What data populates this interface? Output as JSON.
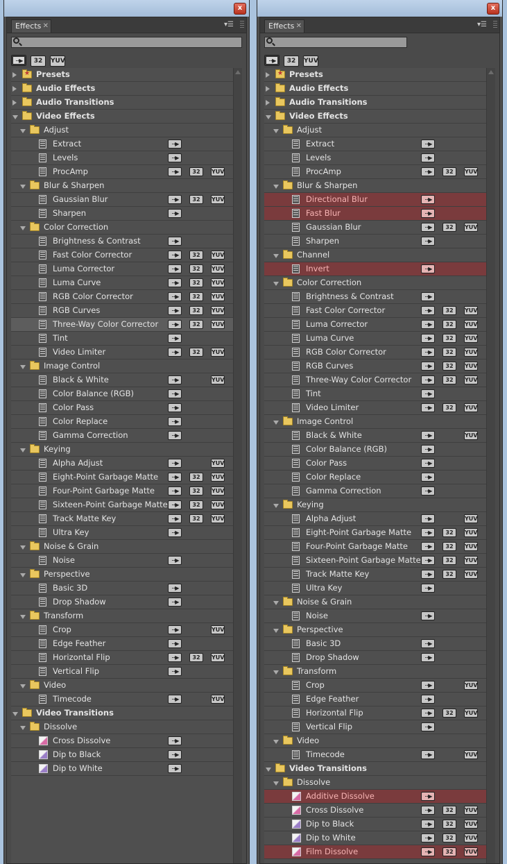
{
  "panels": [
    {
      "tab_label": "Effects",
      "items": [
        {
          "level": 0,
          "kind": "folder",
          "twisty": "closed",
          "label": "Presets",
          "bold": true,
          "star": true
        },
        {
          "level": 0,
          "kind": "folder",
          "twisty": "closed",
          "label": "Audio Effects",
          "bold": true
        },
        {
          "level": 0,
          "kind": "folder",
          "twisty": "closed",
          "label": "Audio Transitions",
          "bold": true
        },
        {
          "level": 0,
          "kind": "folder",
          "twisty": "open",
          "label": "Video Effects",
          "bold": true
        },
        {
          "level": 1,
          "kind": "folder",
          "twisty": "open",
          "label": "Adjust"
        },
        {
          "level": 2,
          "kind": "effect",
          "label": "Extract",
          "acc": true
        },
        {
          "level": 2,
          "kind": "effect",
          "label": "Levels",
          "acc": true
        },
        {
          "level": 2,
          "kind": "effect",
          "label": "ProcAmp",
          "acc": true,
          "b32": true,
          "yuv": true
        },
        {
          "level": 1,
          "kind": "folder",
          "twisty": "open",
          "label": "Blur & Sharpen"
        },
        {
          "level": 2,
          "kind": "effect",
          "label": "Gaussian Blur",
          "acc": true,
          "b32": true,
          "yuv": true
        },
        {
          "level": 2,
          "kind": "effect",
          "label": "Sharpen",
          "acc": true
        },
        {
          "level": 1,
          "kind": "folder",
          "twisty": "open",
          "label": "Color Correction"
        },
        {
          "level": 2,
          "kind": "effect",
          "label": "Brightness & Contrast",
          "acc": true
        },
        {
          "level": 2,
          "kind": "effect",
          "label": "Fast Color Corrector",
          "acc": true,
          "b32": true,
          "yuv": true
        },
        {
          "level": 2,
          "kind": "effect",
          "label": "Luma Corrector",
          "acc": true,
          "b32": true,
          "yuv": true
        },
        {
          "level": 2,
          "kind": "effect",
          "label": "Luma Curve",
          "acc": true,
          "b32": true,
          "yuv": true
        },
        {
          "level": 2,
          "kind": "effect",
          "label": "RGB Color Corrector",
          "acc": true,
          "b32": true,
          "yuv": true
        },
        {
          "level": 2,
          "kind": "effect",
          "label": "RGB Curves",
          "acc": true,
          "b32": true,
          "yuv": true
        },
        {
          "level": 2,
          "kind": "effect",
          "label": "Three-Way Color Corrector",
          "acc": true,
          "b32": true,
          "yuv": true,
          "selected": true
        },
        {
          "level": 2,
          "kind": "effect",
          "label": "Tint",
          "acc": true
        },
        {
          "level": 2,
          "kind": "effect",
          "label": "Video Limiter",
          "acc": true,
          "b32": true,
          "yuv": true
        },
        {
          "level": 1,
          "kind": "folder",
          "twisty": "open",
          "label": "Image Control"
        },
        {
          "level": 2,
          "kind": "effect",
          "label": "Black & White",
          "acc": true,
          "yuv": true
        },
        {
          "level": 2,
          "kind": "effect",
          "label": "Color Balance (RGB)",
          "acc": true
        },
        {
          "level": 2,
          "kind": "effect",
          "label": "Color Pass",
          "acc": true
        },
        {
          "level": 2,
          "kind": "effect",
          "label": "Color Replace",
          "acc": true
        },
        {
          "level": 2,
          "kind": "effect",
          "label": "Gamma Correction",
          "acc": true
        },
        {
          "level": 1,
          "kind": "folder",
          "twisty": "open",
          "label": "Keying"
        },
        {
          "level": 2,
          "kind": "effect",
          "label": "Alpha Adjust",
          "acc": true,
          "yuv": true
        },
        {
          "level": 2,
          "kind": "effect",
          "label": "Eight-Point Garbage Matte",
          "acc": true,
          "b32": true,
          "yuv": true
        },
        {
          "level": 2,
          "kind": "effect",
          "label": "Four-Point Garbage Matte",
          "acc": true,
          "b32": true,
          "yuv": true
        },
        {
          "level": 2,
          "kind": "effect",
          "label": "Sixteen-Point Garbage Matte",
          "acc": true,
          "b32": true,
          "yuv": true
        },
        {
          "level": 2,
          "kind": "effect",
          "label": "Track Matte Key",
          "acc": true,
          "b32": true,
          "yuv": true
        },
        {
          "level": 2,
          "kind": "effect",
          "label": "Ultra Key",
          "acc": true
        },
        {
          "level": 1,
          "kind": "folder",
          "twisty": "open",
          "label": "Noise & Grain"
        },
        {
          "level": 2,
          "kind": "effect",
          "label": "Noise",
          "acc": true
        },
        {
          "level": 1,
          "kind": "folder",
          "twisty": "open",
          "label": "Perspective"
        },
        {
          "level": 2,
          "kind": "effect",
          "label": "Basic 3D",
          "acc": true
        },
        {
          "level": 2,
          "kind": "effect",
          "label": "Drop Shadow",
          "acc": true
        },
        {
          "level": 1,
          "kind": "folder",
          "twisty": "open",
          "label": "Transform"
        },
        {
          "level": 2,
          "kind": "effect",
          "label": "Crop",
          "acc": true,
          "yuv": true
        },
        {
          "level": 2,
          "kind": "effect",
          "label": "Edge Feather",
          "acc": true
        },
        {
          "level": 2,
          "kind": "effect",
          "label": "Horizontal Flip",
          "acc": true,
          "b32": true,
          "yuv": true
        },
        {
          "level": 2,
          "kind": "effect",
          "label": "Vertical Flip",
          "acc": true
        },
        {
          "level": 1,
          "kind": "folder",
          "twisty": "open",
          "label": "Video"
        },
        {
          "level": 2,
          "kind": "effect",
          "label": "Timecode",
          "acc": true,
          "yuv": true
        },
        {
          "level": 0,
          "kind": "folder",
          "twisty": "open",
          "label": "Video Transitions",
          "bold": true
        },
        {
          "level": 1,
          "kind": "folder",
          "twisty": "open",
          "label": "Dissolve"
        },
        {
          "level": 2,
          "kind": "transition",
          "label": "Cross Dissolve",
          "acc": true,
          "pink": true
        },
        {
          "level": 2,
          "kind": "transition",
          "label": "Dip to Black",
          "acc": true
        },
        {
          "level": 2,
          "kind": "transition",
          "label": "Dip to White",
          "acc": true
        }
      ]
    },
    {
      "tab_label": "Effects",
      "items": [
        {
          "level": 0,
          "kind": "folder",
          "twisty": "closed",
          "label": "Presets",
          "bold": true,
          "star": true
        },
        {
          "level": 0,
          "kind": "folder",
          "twisty": "closed",
          "label": "Audio Effects",
          "bold": true
        },
        {
          "level": 0,
          "kind": "folder",
          "twisty": "closed",
          "label": "Audio Transitions",
          "bold": true
        },
        {
          "level": 0,
          "kind": "folder",
          "twisty": "open",
          "label": "Video Effects",
          "bold": true
        },
        {
          "level": 1,
          "kind": "folder",
          "twisty": "open",
          "label": "Adjust"
        },
        {
          "level": 2,
          "kind": "effect",
          "label": "Extract",
          "acc": true
        },
        {
          "level": 2,
          "kind": "effect",
          "label": "Levels",
          "acc": true
        },
        {
          "level": 2,
          "kind": "effect",
          "label": "ProcAmp",
          "acc": true,
          "b32": true,
          "yuv": true
        },
        {
          "level": 1,
          "kind": "folder",
          "twisty": "open",
          "label": "Blur & Sharpen"
        },
        {
          "level": 2,
          "kind": "effect",
          "label": "Directional Blur",
          "acc": true,
          "highlight": true
        },
        {
          "level": 2,
          "kind": "effect",
          "label": "Fast Blur",
          "acc": true,
          "highlight": true
        },
        {
          "level": 2,
          "kind": "effect",
          "label": "Gaussian Blur",
          "acc": true,
          "b32": true,
          "yuv": true
        },
        {
          "level": 2,
          "kind": "effect",
          "label": "Sharpen",
          "acc": true
        },
        {
          "level": 1,
          "kind": "folder",
          "twisty": "open",
          "label": "Channel"
        },
        {
          "level": 2,
          "kind": "effect",
          "label": "Invert",
          "acc": true,
          "highlight": true
        },
        {
          "level": 1,
          "kind": "folder",
          "twisty": "open",
          "label": "Color Correction"
        },
        {
          "level": 2,
          "kind": "effect",
          "label": "Brightness & Contrast",
          "acc": true
        },
        {
          "level": 2,
          "kind": "effect",
          "label": "Fast Color Corrector",
          "acc": true,
          "b32": true,
          "yuv": true
        },
        {
          "level": 2,
          "kind": "effect",
          "label": "Luma Corrector",
          "acc": true,
          "b32": true,
          "yuv": true
        },
        {
          "level": 2,
          "kind": "effect",
          "label": "Luma Curve",
          "acc": true,
          "b32": true,
          "yuv": true
        },
        {
          "level": 2,
          "kind": "effect",
          "label": "RGB Color Corrector",
          "acc": true,
          "b32": true,
          "yuv": true
        },
        {
          "level": 2,
          "kind": "effect",
          "label": "RGB Curves",
          "acc": true,
          "b32": true,
          "yuv": true
        },
        {
          "level": 2,
          "kind": "effect",
          "label": "Three-Way Color Corrector",
          "acc": true,
          "b32": true,
          "yuv": true
        },
        {
          "level": 2,
          "kind": "effect",
          "label": "Tint",
          "acc": true
        },
        {
          "level": 2,
          "kind": "effect",
          "label": "Video Limiter",
          "acc": true,
          "b32": true,
          "yuv": true
        },
        {
          "level": 1,
          "kind": "folder",
          "twisty": "open",
          "label": "Image Control"
        },
        {
          "level": 2,
          "kind": "effect",
          "label": "Black & White",
          "acc": true,
          "yuv": true
        },
        {
          "level": 2,
          "kind": "effect",
          "label": "Color Balance (RGB)",
          "acc": true
        },
        {
          "level": 2,
          "kind": "effect",
          "label": "Color Pass",
          "acc": true
        },
        {
          "level": 2,
          "kind": "effect",
          "label": "Color Replace",
          "acc": true
        },
        {
          "level": 2,
          "kind": "effect",
          "label": "Gamma Correction",
          "acc": true
        },
        {
          "level": 1,
          "kind": "folder",
          "twisty": "open",
          "label": "Keying"
        },
        {
          "level": 2,
          "kind": "effect",
          "label": "Alpha Adjust",
          "acc": true,
          "yuv": true
        },
        {
          "level": 2,
          "kind": "effect",
          "label": "Eight-Point Garbage Matte",
          "acc": true,
          "b32": true,
          "yuv": true
        },
        {
          "level": 2,
          "kind": "effect",
          "label": "Four-Point Garbage Matte",
          "acc": true,
          "b32": true,
          "yuv": true
        },
        {
          "level": 2,
          "kind": "effect",
          "label": "Sixteen-Point Garbage Matte",
          "acc": true,
          "b32": true,
          "yuv": true
        },
        {
          "level": 2,
          "kind": "effect",
          "label": "Track Matte Key",
          "acc": true,
          "b32": true,
          "yuv": true
        },
        {
          "level": 2,
          "kind": "effect",
          "label": "Ultra Key",
          "acc": true
        },
        {
          "level": 1,
          "kind": "folder",
          "twisty": "open",
          "label": "Noise & Grain"
        },
        {
          "level": 2,
          "kind": "effect",
          "label": "Noise",
          "acc": true
        },
        {
          "level": 1,
          "kind": "folder",
          "twisty": "open",
          "label": "Perspective"
        },
        {
          "level": 2,
          "kind": "effect",
          "label": "Basic 3D",
          "acc": true
        },
        {
          "level": 2,
          "kind": "effect",
          "label": "Drop Shadow",
          "acc": true
        },
        {
          "level": 1,
          "kind": "folder",
          "twisty": "open",
          "label": "Transform"
        },
        {
          "level": 2,
          "kind": "effect",
          "label": "Crop",
          "acc": true,
          "yuv": true
        },
        {
          "level": 2,
          "kind": "effect",
          "label": "Edge Feather",
          "acc": true
        },
        {
          "level": 2,
          "kind": "effect",
          "label": "Horizontal Flip",
          "acc": true,
          "b32": true,
          "yuv": true
        },
        {
          "level": 2,
          "kind": "effect",
          "label": "Vertical Flip",
          "acc": true
        },
        {
          "level": 1,
          "kind": "folder",
          "twisty": "open",
          "label": "Video"
        },
        {
          "level": 2,
          "kind": "effect",
          "label": "Timecode",
          "acc": true,
          "yuv": true
        },
        {
          "level": 0,
          "kind": "folder",
          "twisty": "open",
          "label": "Video Transitions",
          "bold": true
        },
        {
          "level": 1,
          "kind": "folder",
          "twisty": "open",
          "label": "Dissolve"
        },
        {
          "level": 2,
          "kind": "transition",
          "label": "Additive Dissolve",
          "acc": true,
          "pink": true,
          "highlight": true
        },
        {
          "level": 2,
          "kind": "transition",
          "label": "Cross Dissolve",
          "acc": true,
          "b32": true,
          "yuv": true,
          "pink": true
        },
        {
          "level": 2,
          "kind": "transition",
          "label": "Dip to Black",
          "acc": true,
          "b32": true,
          "yuv": true
        },
        {
          "level": 2,
          "kind": "transition",
          "label": "Dip to White",
          "acc": true,
          "b32": true,
          "yuv": true
        },
        {
          "level": 2,
          "kind": "transition",
          "label": "Film Dissolve",
          "acc": true,
          "b32": true,
          "yuv": true,
          "pink": true,
          "highlight": true
        }
      ]
    }
  ],
  "filters": {
    "b32_label": "32",
    "yuv_label": "YUV"
  },
  "badges": {
    "b32": "32",
    "yuv": "YUV"
  },
  "close_glyph": "x",
  "colors": {
    "panel": "#4f4f4f",
    "highlight_row": "#7a3b3d",
    "selected_row": "#5d5d5d",
    "window_frame": "#aac3de"
  }
}
